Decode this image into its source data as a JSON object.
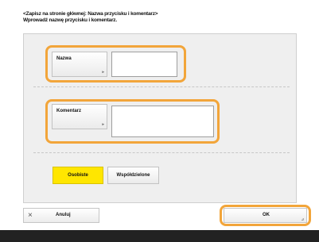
{
  "header": {
    "line1": "<Zapisz na stronie głównej: Nazwa przycisku i komentarz>",
    "line2": "Wprowadź nazwę przycisku i komentarz."
  },
  "name_row": {
    "button_label": "Nazwa",
    "value": ""
  },
  "comment_row": {
    "button_label": "Komentarz",
    "value": ""
  },
  "toggle": {
    "private_label": "Osobiste",
    "shared_label": "Współdzielone",
    "selected": "Osobiste"
  },
  "footer": {
    "cancel_label": "Anuluj",
    "ok_label": "OK"
  },
  "colors": {
    "highlight": "#f2a53a",
    "selected": "#ffe600",
    "bottom_bar": "#222222"
  },
  "icons": {
    "cancel": "close-icon",
    "button_arrow": "triangle-arrow-icon",
    "ok_corner": "corner-arrow-icon"
  }
}
